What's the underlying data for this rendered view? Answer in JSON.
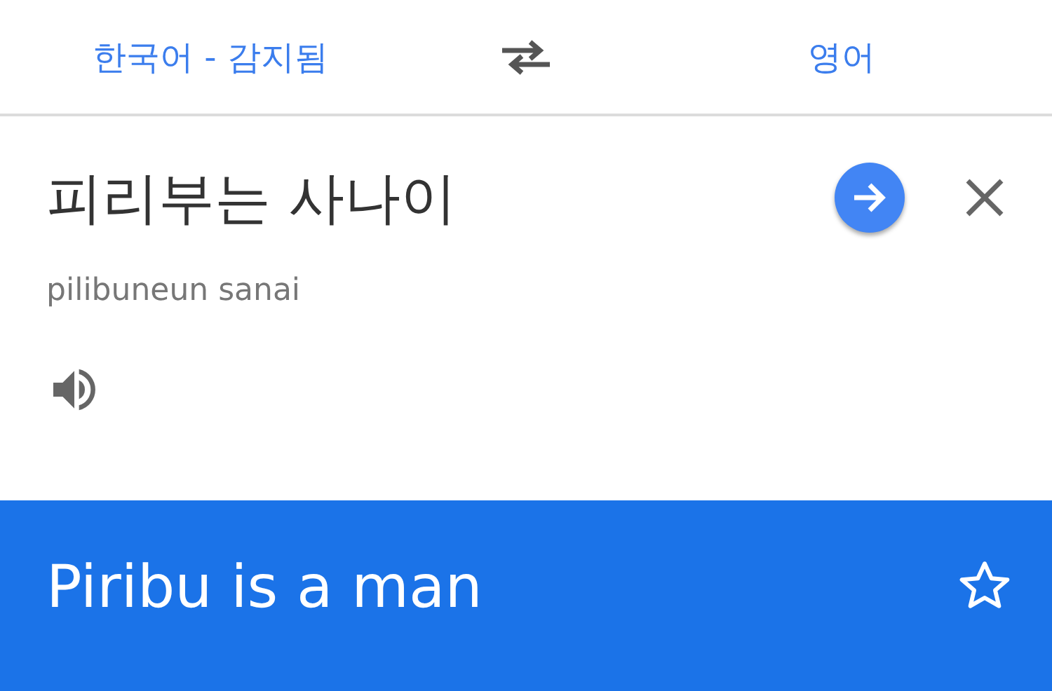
{
  "language_bar": {
    "source_language": "한국어 - 감지됨",
    "target_language": "영어"
  },
  "input": {
    "text": "피리부는 사나이",
    "transliteration": "pilibuneun sanai"
  },
  "translation": {
    "text": "Piribu is a man",
    "starred": false
  }
}
